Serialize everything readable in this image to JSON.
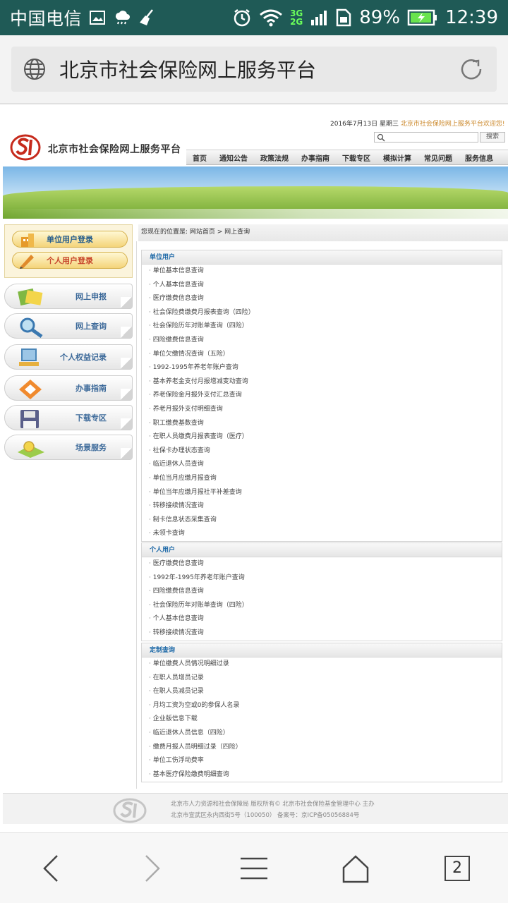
{
  "status_bar": {
    "carrier": "中国电信",
    "battery": "89%",
    "time": "12:39",
    "network": [
      "3G",
      "2G"
    ]
  },
  "address_bar": {
    "page_title": "北京市社会保险网上服务平台"
  },
  "header": {
    "date": "2016年7月13日 星期三",
    "welcome": "北京市社会保险网上服务平台欢迎您!",
    "search_button": "搜索",
    "site_title": "北京市社会保险网上服务平台",
    "nav": [
      "首页",
      "通知公告",
      "政策法规",
      "办事指南",
      "下载专区",
      "模拟计算",
      "常见问题",
      "服务信息"
    ]
  },
  "sidebar": {
    "unit_login": "单位用户登录",
    "personal_login": "个人用户登录",
    "items": [
      "网上申报",
      "网上查询",
      "个人权益记录",
      "办事指南",
      "下载专区",
      "场景服务"
    ]
  },
  "breadcrumb": "您现在的位置是: 网站首页 > 网上查询",
  "sections": [
    {
      "title": "单位用户",
      "items": [
        "单位基本信息查询",
        "个人基本信息查询",
        "医疗缴费信息查询",
        "社会保险费缴费月报表查询（四险）",
        "社会保险历年对账单查询（四险）",
        "四险缴费信息查询",
        "单位欠缴情况查询（五险）",
        "1992-1995年养老年账户查询",
        "基本养老金支付月报增减变动查询",
        "养老保险金月报外支付汇总查询",
        "养老月报外支付明细查询",
        "职工缴费基数查询",
        "在职人员缴费月报表查询（医疗）",
        "社保卡办理状态查询",
        "临近退休人员查询",
        "单位当月应缴月报查询",
        "单位当年应缴月报社平补差查询",
        "转移接续情况查询",
        "制卡信息状态采集查询",
        "未领卡查询"
      ]
    },
    {
      "title": "个人用户",
      "items": [
        "医疗缴费信息查询",
        "1992年-1995年养老年账户查询",
        "四险缴费信息查询",
        "社会保险历年对账单查询（四险）",
        "个人基本信息查询",
        "转移接续情况查询"
      ]
    },
    {
      "title": "定制查询",
      "items": [
        "单位缴费人员情况明细过录",
        "在职人员增员记录",
        "在职人员减员记录",
        "月均工资为空或0的参保人名录",
        "企业版信息下载",
        "临近退休人员信息（四险）",
        "缴费月报人员明细过录（四险）",
        "单位工伤浮动费率",
        "基本医疗保险缴费明细查询"
      ]
    }
  ],
  "footer": {
    "line1": "北京市人力资源和社会保障局 版权所有© 北京市社会保险基金管理中心 主办",
    "line2": "北京市宣武区永内西街5号（100050） 备案号：京ICP备05056884号"
  },
  "bottom_bar": {
    "tab_count": "2"
  }
}
